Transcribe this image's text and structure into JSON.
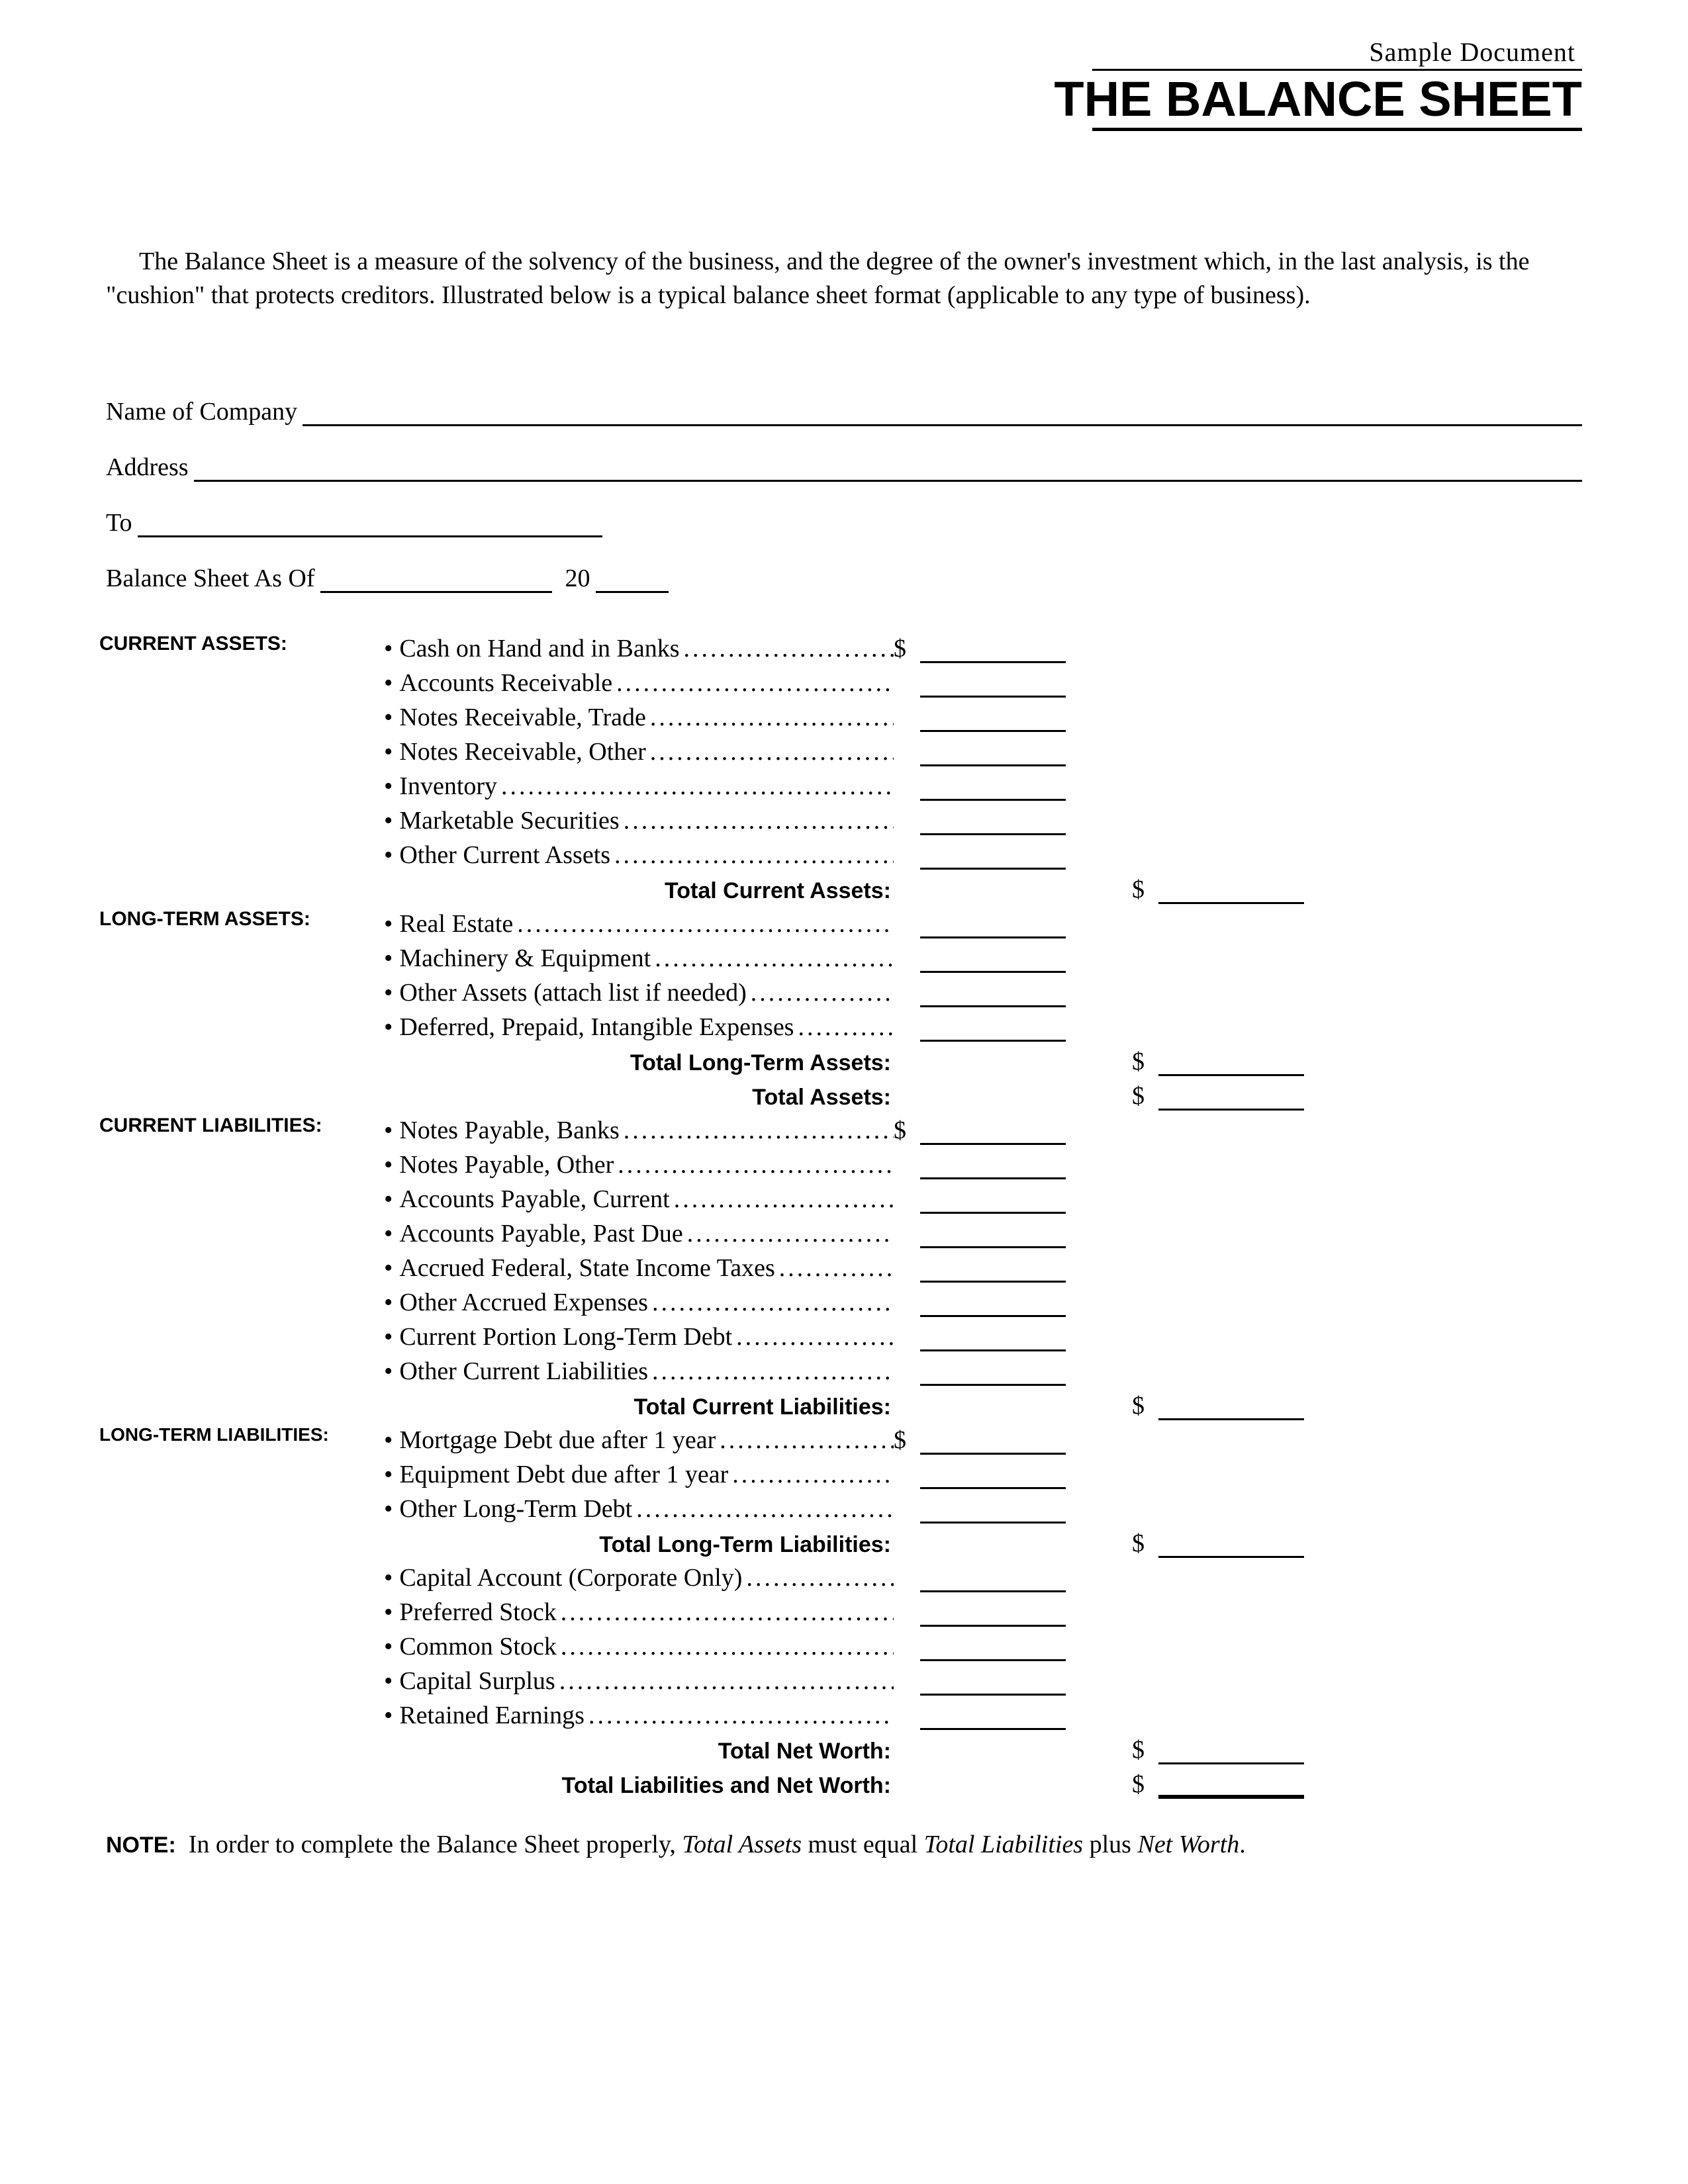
{
  "header": {
    "sample": "Sample Document",
    "title": "THE BALANCE SHEET"
  },
  "intro": "The Balance Sheet is a measure of the solvency of the business, and the degree of the owner's investment which, in the last analysis, is the \"cushion\" that protects creditors. Illustrated below is a typical balance sheet format (applicable to any type of business).",
  "fields": {
    "company_label": "Name of Company",
    "address_label": "Address",
    "to_label": "To",
    "asof_label": "Balance Sheet As Of",
    "century": "20"
  },
  "sections": {
    "current_assets": {
      "heading": "CURRENT ASSETS:",
      "items": [
        "Cash on Hand and in Banks",
        "Accounts Receivable",
        "Notes Receivable, Trade",
        "Notes Receivable, Other",
        "Inventory",
        "Marketable Securities",
        "Other Current Assets"
      ],
      "total_label": "Total Current Assets:"
    },
    "long_term_assets": {
      "heading": "LONG-TERM ASSETS:",
      "items": [
        "Real Estate",
        "Machinery & Equipment",
        "Other Assets (attach list if needed)",
        "Deferred, Prepaid, Intangible Expenses"
      ],
      "total_label": "Total Long-Term Assets:",
      "grand_total_label": "Total Assets:"
    },
    "current_liabilities": {
      "heading": "CURRENT LIABILITIES:",
      "items": [
        "Notes Payable, Banks",
        "Notes Payable, Other",
        "Accounts Payable, Current",
        "Accounts Payable, Past Due",
        "Accrued Federal, State Income Taxes",
        "Other Accrued Expenses",
        "Current Portion Long-Term Debt",
        "Other Current Liabilities"
      ],
      "total_label": "Total Current Liabilities:"
    },
    "long_term_liabilities": {
      "heading": "LONG-TERM LIABILITIES:",
      "items": [
        "Mortgage Debt due after 1 year",
        "Equipment Debt due after 1 year",
        "Other Long-Term Debt"
      ],
      "total_label": "Total Long-Term Liabilities:"
    },
    "equity": {
      "items": [
        "Capital Account (Corporate Only)",
        "Preferred Stock",
        "Common Stock",
        "Capital Surplus",
        "Retained Earnings"
      ],
      "net_worth_label": "Total Net Worth:",
      "grand_total_label": "Total Liabilities and Net Worth:"
    }
  },
  "currency": "$",
  "note": {
    "label": "NOTE:",
    "pre": "In order to complete the Balance Sheet properly, ",
    "i1": "Total Assets",
    "mid1": " must equal ",
    "i2": "Total Liabilities",
    "mid2": " plus ",
    "i3": "Net Worth",
    "post": "."
  }
}
